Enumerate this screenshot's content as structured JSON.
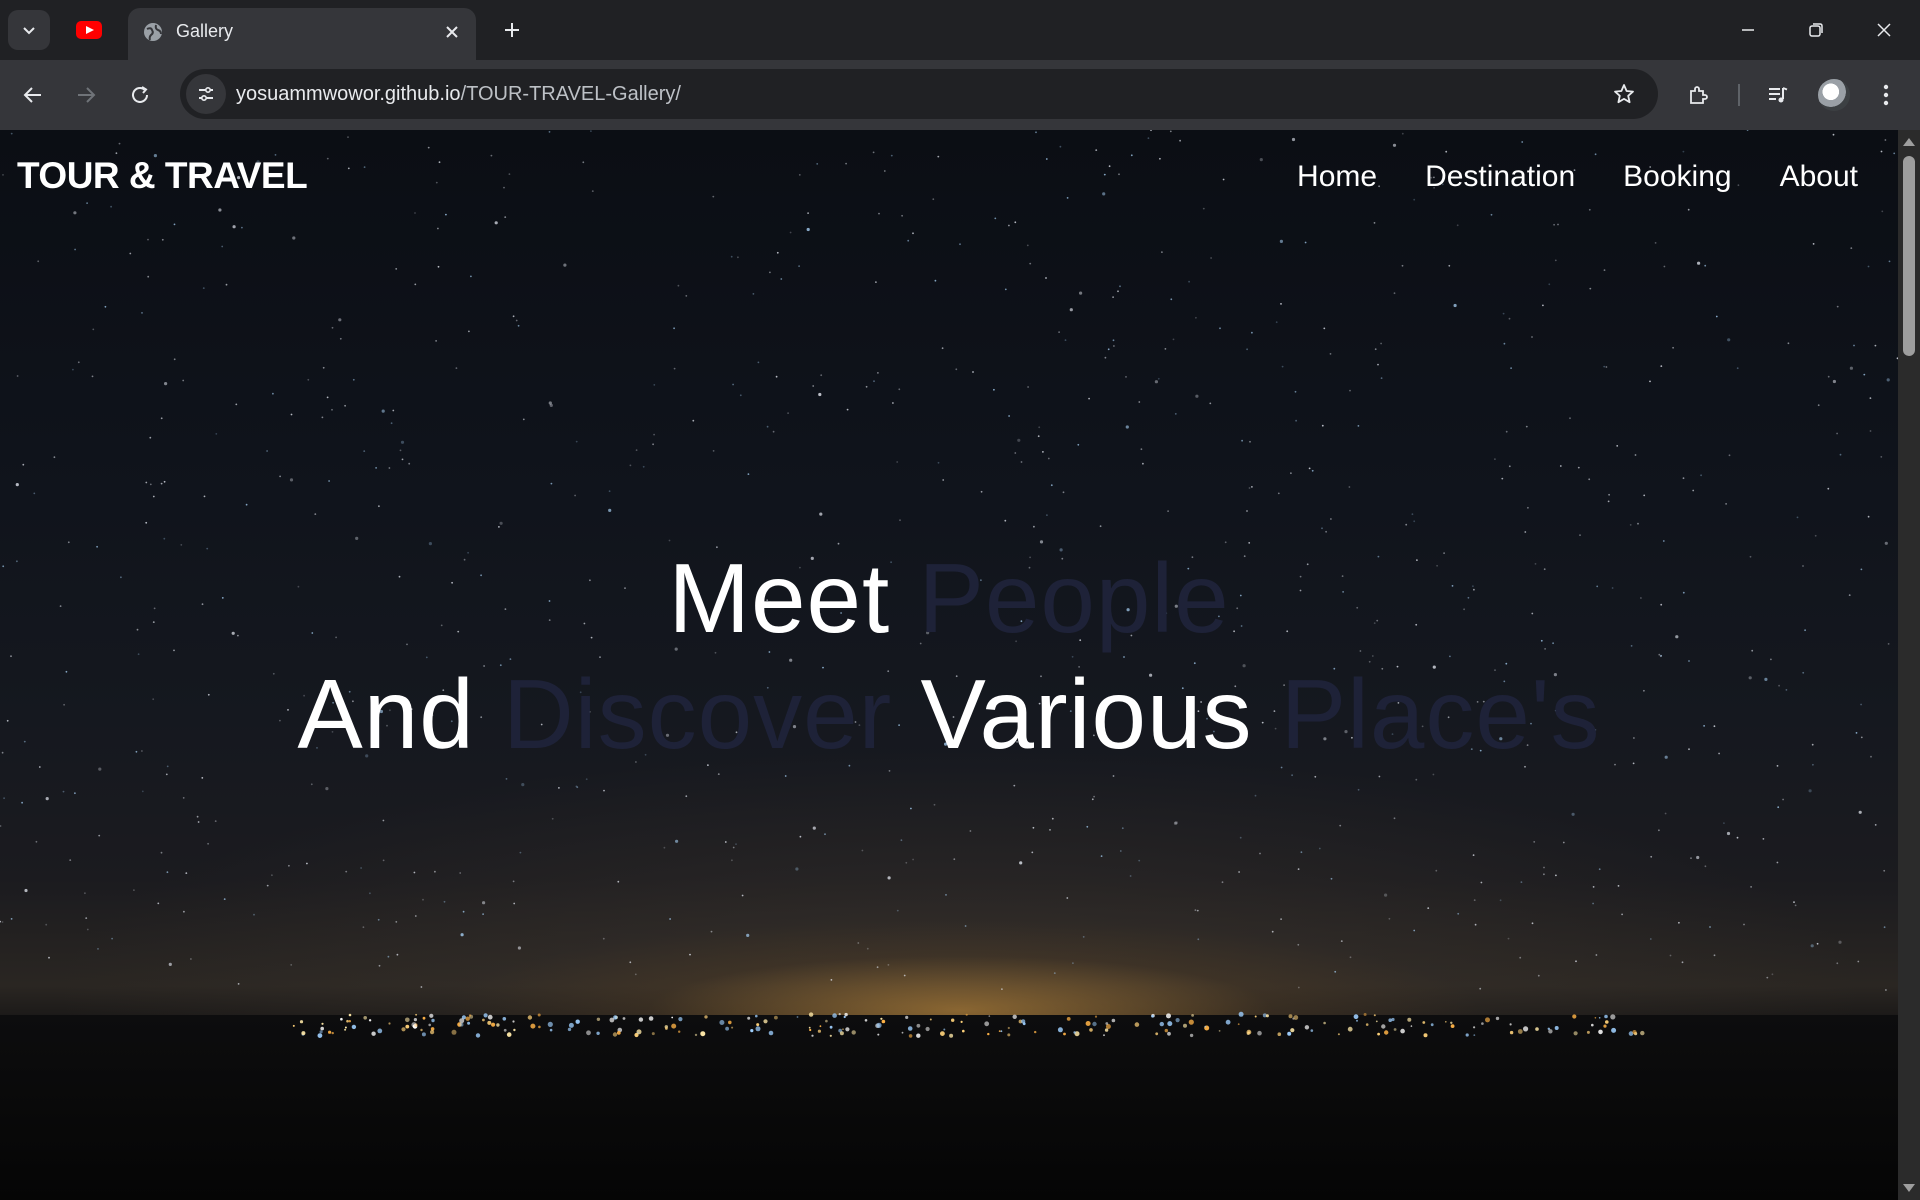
{
  "browser": {
    "tab": {
      "title": "Gallery"
    },
    "url": {
      "host": "yosuammwowor.github.io",
      "path": "/TOUR-TRAVEL-Gallery/"
    }
  },
  "site": {
    "brand": "TOUR & TRAVEL",
    "nav": [
      "Home",
      "Destination",
      "Booking",
      "About"
    ]
  },
  "hero": {
    "line1": [
      {
        "text": "Meet",
        "accent": false
      },
      {
        "text": "People",
        "accent": true
      }
    ],
    "line2": [
      {
        "text": "And",
        "accent": false
      },
      {
        "text": "Discover",
        "accent": true
      },
      {
        "text": "Various",
        "accent": false
      },
      {
        "text": "Place's",
        "accent": true
      }
    ]
  },
  "colors": {
    "hero_text": "#ffffff",
    "hero_accent": "#1e2238",
    "chrome_bg": "#202124",
    "toolbar_bg": "#35363a"
  },
  "icons": [
    "tab-search-icon",
    "youtube-icon",
    "globe-icon",
    "close-icon",
    "plus-icon",
    "minimize-icon",
    "restore-icon",
    "back-icon",
    "forward-icon",
    "reload-icon",
    "site-info-icon",
    "star-icon",
    "extensions-icon",
    "media-icon",
    "profile-avatar",
    "menu-icon"
  ]
}
